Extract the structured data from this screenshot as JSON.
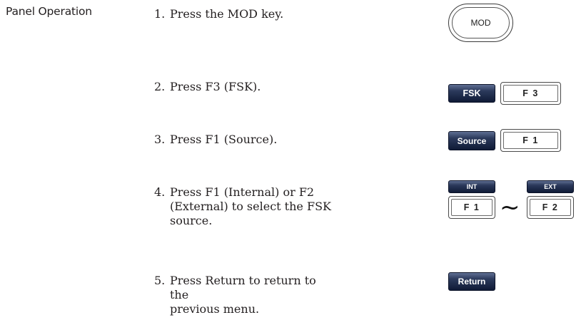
{
  "section_label": "Panel Operation",
  "steps": [
    {
      "num": "1.",
      "lines": [
        "Press the MOD key."
      ]
    },
    {
      "num": "2.",
      "lines": [
        "Press F3 (FSK)."
      ]
    },
    {
      "num": "3.",
      "lines": [
        "Press F1 (Source)."
      ]
    },
    {
      "num": "4.",
      "lines": [
        "Press F1 (Internal) or F2",
        "(External) to select the FSK",
        "source."
      ]
    },
    {
      "num": "5.",
      "lines": [
        "Press Return to return to the",
        "previous menu."
      ]
    }
  ],
  "keys": {
    "mod": "MOD",
    "fsk_softkey": "FSK",
    "f3": "F 3",
    "source_softkey": "Source",
    "f1_a": "F 1",
    "int_softkey": "INT",
    "ext_softkey": "EXT",
    "f1_b": "F 1",
    "f2": "F 2",
    "return_softkey": "Return",
    "tilde": "~"
  }
}
